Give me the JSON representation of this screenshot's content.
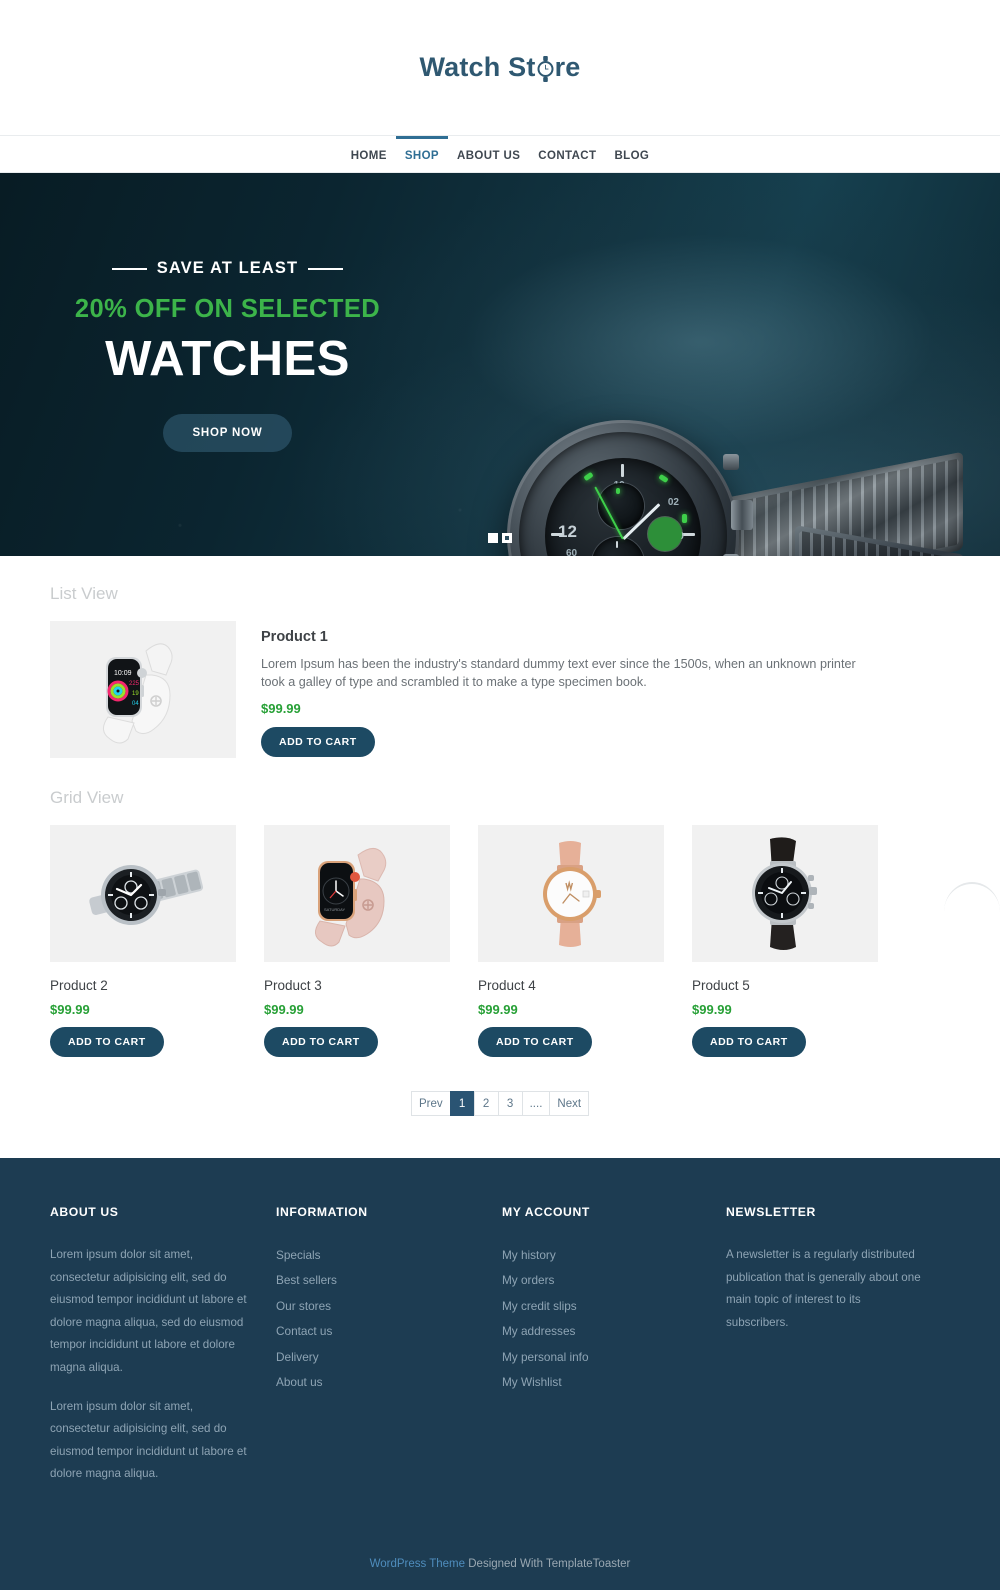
{
  "brand": {
    "name_part1": "Watch St",
    "name_part2": "re",
    "logo_icon": "wristwatch-icon",
    "color": "#2f5871"
  },
  "nav": {
    "items": [
      {
        "label": "HOME",
        "active": false
      },
      {
        "label": "SHOP",
        "active": true
      },
      {
        "label": "ABOUT US",
        "active": false
      },
      {
        "label": "CONTACT",
        "active": false
      },
      {
        "label": "BLOG",
        "active": false
      }
    ]
  },
  "hero": {
    "kicker": "SAVE AT LEAST",
    "subtitle": "20% OFF ON SELECTED",
    "title": "WATCHES",
    "button_label": "SHOP NOW",
    "accent_green": "#3cb44a",
    "background_color": "#0a2028",
    "slides_total": 2,
    "active_slide": 2,
    "image_alt": "black-chronograph-watch-photo"
  },
  "sections": {
    "list_view_heading": "List View",
    "grid_view_heading": "Grid View"
  },
  "list_product": {
    "name": "Product 1",
    "description": "Lorem Ipsum has been the industry's standard dummy text ever since the 1500s, when an unknown printer took a galley of type and scrambled it to make a type specimen book.",
    "price": "$99.99",
    "button_label": "ADD TO CART",
    "image_alt": "white-apple-watch"
  },
  "grid_products": [
    {
      "name": "Product 2",
      "price": "$99.99",
      "button_label": "ADD TO CART",
      "image_alt": "silver-chronograph-watch"
    },
    {
      "name": "Product 3",
      "price": "$99.99",
      "button_label": "ADD TO CART",
      "image_alt": "pink-apple-watch"
    },
    {
      "name": "Product 4",
      "price": "$99.99",
      "button_label": "ADD TO CART",
      "image_alt": "rose-gold-minimalist-watch"
    },
    {
      "name": "Product 5",
      "price": "$99.99",
      "button_label": "ADD TO CART",
      "image_alt": "black-leather-strap-chronograph"
    }
  ],
  "pagination": {
    "prev_label": "Prev",
    "next_label": "Next",
    "pages": [
      "1",
      "2",
      "3",
      "...."
    ],
    "active_page": "1"
  },
  "footer": {
    "about": {
      "title": "ABOUT US",
      "paragraph1": "Lorem ipsum dolor sit amet, consectetur adipisicing elit, sed do eiusmod tempor incididunt ut labore et dolore magna aliqua, sed do eiusmod tempor incididunt ut labore et dolore magna aliqua.",
      "paragraph2": "Lorem ipsum dolor sit amet, consectetur adipisicing elit, sed do eiusmod tempor incididunt ut labore et dolore magna aliqua."
    },
    "information": {
      "title": "INFORMATION",
      "links": [
        "Specials",
        "Best sellers",
        "Our stores",
        "Contact us",
        "Delivery",
        "About us"
      ]
    },
    "my_account": {
      "title": "MY ACCOUNT",
      "links": [
        "My history",
        "My orders",
        "My credit slips",
        "My addresses",
        "My personal info",
        "My Wishlist"
      ]
    },
    "newsletter": {
      "title": "NEWSLETTER",
      "paragraph": "A newsletter is a regularly distributed publication that is generally about one main topic of interest to its subscribers."
    },
    "bottom": {
      "link_text": "WordPress Theme",
      "text": " Designed With TemplateToaster"
    },
    "background_color": "#1d3c52"
  }
}
